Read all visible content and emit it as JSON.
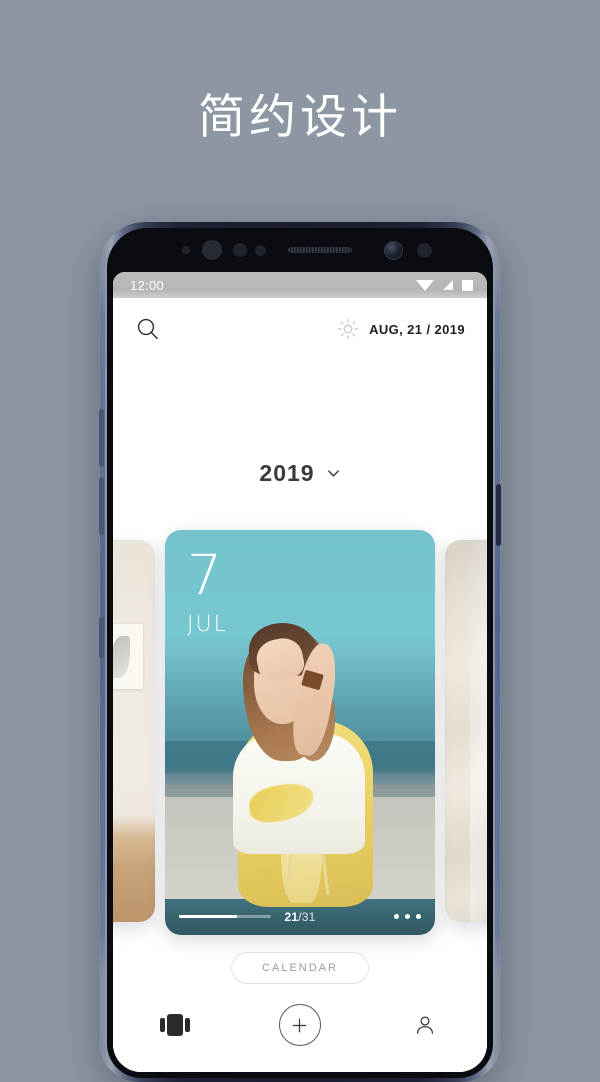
{
  "promo": {
    "headline": "简约设计"
  },
  "device": {
    "icons": {
      "earpiece": "speaker-grille",
      "front_camera": "front-camera-icon",
      "proximity_sensor": "proximity-sensor-icon",
      "iris_scanner": "iris-scanner-icon"
    },
    "buttons": {
      "volume_up": "volume-up-button",
      "volume_down": "volume-down-button",
      "assistant": "assistant-button",
      "power": "power-button"
    }
  },
  "statusbar": {
    "time": "12:00",
    "icons": [
      "wifi-icon",
      "signal-icon",
      "battery-icon"
    ]
  },
  "appbar": {
    "search_icon": "search-icon",
    "weather_icon": "sun-icon",
    "date": "AUG, 21 / 2019"
  },
  "year_selector": {
    "label": "2019",
    "chevron": "chevron-down-icon"
  },
  "carousel": {
    "main_card": {
      "day": "7",
      "month": "JUL",
      "count_current": "21",
      "count_separator": "/",
      "count_total": "31",
      "progress_percent": 63,
      "more_icon": "more-dots-icon"
    },
    "peek_left": {
      "alt": "interior-photo-card"
    },
    "peek_right": {
      "alt": "fabric-photo-card"
    }
  },
  "calendar_button": {
    "label": "CALENDAR"
  },
  "bottom_nav": {
    "items": [
      {
        "name": "cards-view",
        "icon": "cards-icon"
      },
      {
        "name": "add",
        "icon": "plus-icon"
      },
      {
        "name": "profile",
        "icon": "person-icon"
      }
    ]
  },
  "colors": {
    "page_background": "#8d97a3",
    "card_teal": "#74c3cd",
    "accent_yellow": "#ecd569",
    "text_dark": "#1f1f1f",
    "muted": "#9b9b9b"
  }
}
